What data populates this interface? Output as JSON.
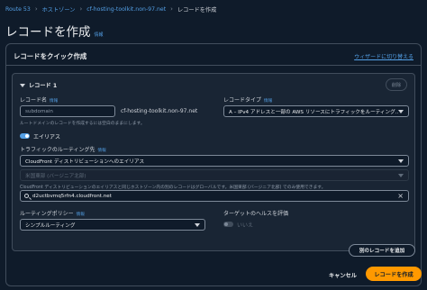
{
  "breadcrumb": {
    "items": [
      "Route 53",
      "ホストゾーン",
      "cf-hosting-toolkit.non-97.net"
    ],
    "current": "レコードを作成",
    "separator": "›"
  },
  "page": {
    "title": "レコードを作成",
    "info": "情報"
  },
  "panel": {
    "title": "レコードをクイック作成",
    "wizard_link": "ウィザードに切り替える"
  },
  "record": {
    "title": "レコード 1",
    "delete_label": "削除",
    "name_label": "レコード名",
    "name_info": "情報",
    "name_value": "subdomain",
    "domain_suffix": "cf-hosting-toolkit.non-97.net",
    "name_hint": "ルートドメインのレコードを作成するには空白のままにします。",
    "type_label": "レコードタイプ",
    "type_info": "情報",
    "type_value": "A – IPv4 アドレスと一部の AWS リソースにトラフィックをルーティング...",
    "alias_label": "エイリアス",
    "routing_target_label": "トラフィックのルーティング先",
    "routing_target_info": "情報",
    "routing_target_value": "CloudFront ディストリビューションへのエイリアス",
    "region_placeholder": "米国東部 (バージニア北部)",
    "region_hint": "CloudFront ディストリビューションのエイリアスと同じホストゾーン内の別のレコードはグローバルです。米国東部 (バージニア北部) でのみ使用できます。",
    "distribution_value": "d2uctbvmq5rfn4.cloudfront.net",
    "routing_policy_label": "ルーティングポリシー",
    "routing_policy_info": "情報",
    "routing_policy_value": "シンプルルーティング",
    "health_label": "ターゲットのヘルスを評価",
    "health_value": "いいえ"
  },
  "actions": {
    "add_record": "別のレコードを追加",
    "cancel": "キャンセル",
    "create": "レコードを作成"
  },
  "colors": {
    "accent": "#539fe5",
    "primary_button": "#ff9900",
    "background": "#0f1b2a"
  }
}
